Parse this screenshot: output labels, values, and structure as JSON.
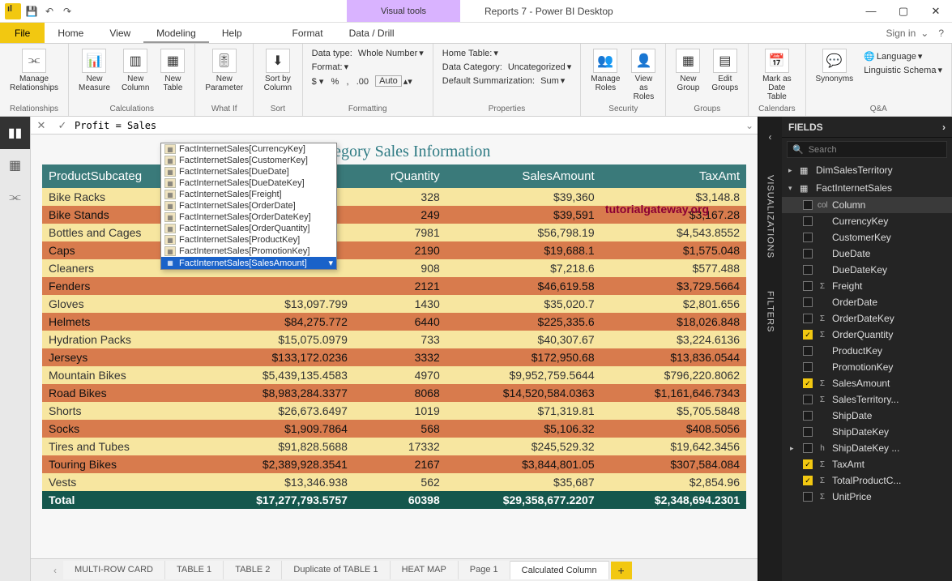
{
  "window": {
    "visual_tools": "Visual tools",
    "title": "Reports 7 - Power BI Desktop",
    "file_tab": "File",
    "tabs": [
      "Home",
      "View",
      "Modeling",
      "Help"
    ],
    "active_tab": "Modeling",
    "vtabs": [
      "Format",
      "Data / Drill"
    ],
    "signin": "Sign in"
  },
  "ribbon": {
    "relationships": {
      "btn": "Manage\nRelationships",
      "group": "Relationships"
    },
    "calculations": {
      "b1": "New\nMeasure",
      "b2": "New\nColumn",
      "b3": "New\nTable",
      "group": "Calculations"
    },
    "whatif": {
      "btn": "New\nParameter",
      "group": "What If"
    },
    "sort": {
      "btn": "Sort by\nColumn",
      "group": "Sort"
    },
    "formatting": {
      "datatype_l": "Data type:",
      "datatype_v": "Whole Number",
      "format_l": "Format:",
      "auto": "Auto",
      "group": "Formatting"
    },
    "properties": {
      "hometable_l": "Home Table:",
      "datacat_l": "Data Category:",
      "datacat_v": "Uncategorized",
      "defsum_l": "Default Summarization:",
      "defsum_v": "Sum",
      "group": "Properties"
    },
    "security": {
      "b1": "Manage\nRoles",
      "b2": "View as\nRoles",
      "group": "Security"
    },
    "groups": {
      "b1": "New\nGroup",
      "b2": "Edit\nGroups",
      "group": "Groups"
    },
    "calendars": {
      "btn": "Mark as\nDate Table",
      "group": "Calendars"
    },
    "qa": {
      "btn": "Synonyms",
      "lang": "Language",
      "ling": "Linguistic Schema",
      "group": "Q&A"
    }
  },
  "formula": "Profit = Sales",
  "autocomplete": [
    "FactInternetSales[CurrencyKey]",
    "FactInternetSales[CustomerKey]",
    "FactInternetSales[DueDate]",
    "FactInternetSales[DueDateKey]",
    "FactInternetSales[Freight]",
    "FactInternetSales[OrderDate]",
    "FactInternetSales[OrderDateKey]",
    "FactInternetSales[OrderQuantity]",
    "FactInternetSales[ProductKey]",
    "FactInternetSales[PromotionKey]",
    "FactInternetSales[SalesAmount]"
  ],
  "autocomplete_selected": 10,
  "report_title": "b-Category Sales Information",
  "columns": [
    "ProductSubcateg",
    "",
    "rQuantity",
    "SalesAmount",
    "TaxAmt"
  ],
  "rows": [
    {
      "n": "Bike Racks",
      "c": "",
      "q": "328",
      "s": "$39,360",
      "t": "$3,148.8"
    },
    {
      "n": "Bike Stands",
      "c": "",
      "q": "249",
      "s": "$39,591",
      "t": "$3,167.28"
    },
    {
      "n": "Bottles and Cages",
      "c": "",
      "q": "7981",
      "s": "$56,798.19",
      "t": "$4,543.8552"
    },
    {
      "n": "Caps",
      "c": "",
      "q": "2190",
      "s": "$19,688.1",
      "t": "$1,575.048"
    },
    {
      "n": "Cleaners",
      "c": "",
      "q": "908",
      "s": "$7,218.6",
      "t": "$577.488"
    },
    {
      "n": "Fenders",
      "c": "",
      "q": "2121",
      "s": "$46,619.58",
      "t": "$3,729.5664"
    },
    {
      "n": "Gloves",
      "c": "$13,097.799",
      "q": "1430",
      "s": "$35,020.7",
      "t": "$2,801.656"
    },
    {
      "n": "Helmets",
      "c": "$84,275.772",
      "q": "6440",
      "s": "$225,335.6",
      "t": "$18,026.848"
    },
    {
      "n": "Hydration Packs",
      "c": "$15,075.0979",
      "q": "733",
      "s": "$40,307.67",
      "t": "$3,224.6136"
    },
    {
      "n": "Jerseys",
      "c": "$133,172.0236",
      "q": "3332",
      "s": "$172,950.68",
      "t": "$13,836.0544"
    },
    {
      "n": "Mountain Bikes",
      "c": "$5,439,135.4583",
      "q": "4970",
      "s": "$9,952,759.5644",
      "t": "$796,220.8062"
    },
    {
      "n": "Road Bikes",
      "c": "$8,983,284.3377",
      "q": "8068",
      "s": "$14,520,584.0363",
      "t": "$1,161,646.7343"
    },
    {
      "n": "Shorts",
      "c": "$26,673.6497",
      "q": "1019",
      "s": "$71,319.81",
      "t": "$5,705.5848"
    },
    {
      "n": "Socks",
      "c": "$1,909.7864",
      "q": "568",
      "s": "$5,106.32",
      "t": "$408.5056"
    },
    {
      "n": "Tires and Tubes",
      "c": "$91,828.5688",
      "q": "17332",
      "s": "$245,529.32",
      "t": "$19,642.3456"
    },
    {
      "n": "Touring Bikes",
      "c": "$2,389,928.3541",
      "q": "2167",
      "s": "$3,844,801.05",
      "t": "$307,584.084"
    },
    {
      "n": "Vests",
      "c": "$13,346.938",
      "q": "562",
      "s": "$35,687",
      "t": "$2,854.96"
    }
  ],
  "total": {
    "n": "Total",
    "c": "$17,277,793.5757",
    "q": "60398",
    "s": "$29,358,677.2207",
    "t": "$2,348,694.2301"
  },
  "watermark": "tutorialgateway.org",
  "sheets": [
    "MULTI-ROW CARD",
    "TABLE 1",
    "TABLE 2",
    "Duplicate of TABLE 1",
    "HEAT MAP",
    "Page 1",
    "Calculated Column"
  ],
  "active_sheet": 6,
  "sidepanes": {
    "viz": "VISUALIZATIONS",
    "filters": "FILTERS"
  },
  "fields": {
    "title": "FIELDS",
    "search_ph": "Search",
    "tables": [
      {
        "name": "DimSalesTerritory",
        "open": false
      },
      {
        "name": "FactInternetSales",
        "open": true,
        "fields": [
          {
            "n": "Column",
            "icon": "col",
            "on": false,
            "sel": true
          },
          {
            "n": "CurrencyKey",
            "icon": "",
            "on": false
          },
          {
            "n": "CustomerKey",
            "icon": "",
            "on": false
          },
          {
            "n": "DueDate",
            "icon": "",
            "on": false
          },
          {
            "n": "DueDateKey",
            "icon": "",
            "on": false
          },
          {
            "n": "Freight",
            "icon": "Σ",
            "on": false
          },
          {
            "n": "OrderDate",
            "icon": "",
            "on": false
          },
          {
            "n": "OrderDateKey",
            "icon": "Σ",
            "on": false
          },
          {
            "n": "OrderQuantity",
            "icon": "Σ",
            "on": true
          },
          {
            "n": "ProductKey",
            "icon": "",
            "on": false
          },
          {
            "n": "PromotionKey",
            "icon": "",
            "on": false
          },
          {
            "n": "SalesAmount",
            "icon": "Σ",
            "on": true
          },
          {
            "n": "SalesTerritory...",
            "icon": "Σ",
            "on": false
          },
          {
            "n": "ShipDate",
            "icon": "",
            "on": false
          },
          {
            "n": "ShipDateKey",
            "icon": "",
            "on": false
          },
          {
            "n": "ShipDateKey ...",
            "icon": "h",
            "on": false,
            "expand": true
          },
          {
            "n": "TaxAmt",
            "icon": "Σ",
            "on": true
          },
          {
            "n": "TotalProductC...",
            "icon": "Σ",
            "on": true
          },
          {
            "n": "UnitPrice",
            "icon": "Σ",
            "on": false
          }
        ]
      }
    ]
  }
}
